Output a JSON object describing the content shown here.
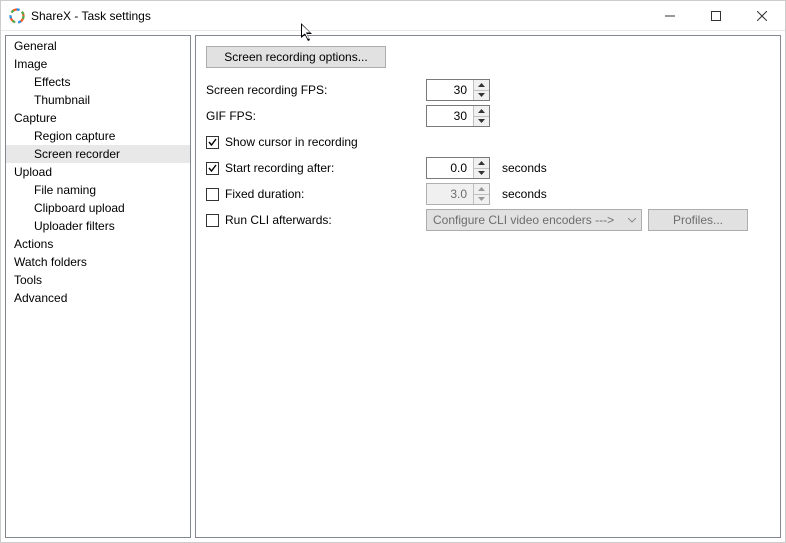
{
  "window": {
    "title": "ShareX - Task settings"
  },
  "sidebar": {
    "items": [
      {
        "label": "General",
        "level": 0
      },
      {
        "label": "Image",
        "level": 0
      },
      {
        "label": "Effects",
        "level": 1
      },
      {
        "label": "Thumbnail",
        "level": 1
      },
      {
        "label": "Capture",
        "level": 0
      },
      {
        "label": "Region capture",
        "level": 1
      },
      {
        "label": "Screen recorder",
        "level": 1,
        "selected": true
      },
      {
        "label": "Upload",
        "level": 0
      },
      {
        "label": "File naming",
        "level": 1
      },
      {
        "label": "Clipboard upload",
        "level": 1
      },
      {
        "label": "Uploader filters",
        "level": 1
      },
      {
        "label": "Actions",
        "level": 0
      },
      {
        "label": "Watch folders",
        "level": 0
      },
      {
        "label": "Tools",
        "level": 0
      },
      {
        "label": "Advanced",
        "level": 0
      }
    ]
  },
  "content": {
    "options_button": "Screen recording options...",
    "fps_label": "Screen recording FPS:",
    "fps_value": "30",
    "gif_fps_label": "GIF FPS:",
    "gif_fps_value": "30",
    "show_cursor_label": "Show cursor in recording",
    "show_cursor_checked": true,
    "start_after_label": "Start recording after:",
    "start_after_checked": true,
    "start_after_value": "0.0",
    "start_after_unit": "seconds",
    "fixed_duration_label": "Fixed duration:",
    "fixed_duration_checked": false,
    "fixed_duration_value": "3.0",
    "fixed_duration_unit": "seconds",
    "run_cli_label": "Run CLI afterwards:",
    "run_cli_checked": false,
    "cli_combo": "Configure CLI video encoders --->",
    "profiles_button": "Profiles..."
  }
}
